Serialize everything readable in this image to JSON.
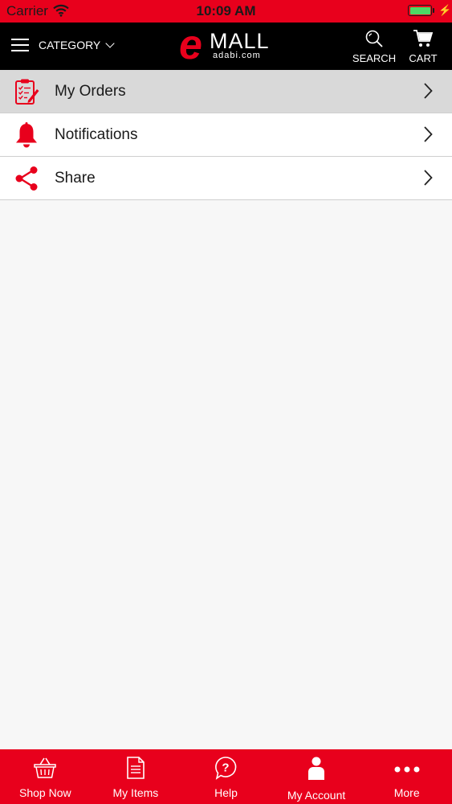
{
  "status_bar": {
    "carrier": "Carrier",
    "time": "10:09 AM",
    "battery_level": 1.0
  },
  "header": {
    "category_label": "CATEGORY",
    "logo_mark": "e",
    "logo_text": "MALL",
    "logo_subtext": "adabi.com",
    "search_label": "SEARCH",
    "cart_label": "CART"
  },
  "menu": {
    "items": [
      {
        "label": "My Orders",
        "icon": "clipboard-checklist-icon",
        "selected": true
      },
      {
        "label": "Notifications",
        "icon": "bell-icon",
        "selected": false
      },
      {
        "label": "Share",
        "icon": "share-icon",
        "selected": false
      }
    ]
  },
  "tabs": [
    {
      "label": "Shop Now",
      "icon": "basket-icon"
    },
    {
      "label": "My Items",
      "icon": "document-icon"
    },
    {
      "label": "Help",
      "icon": "help-bubble-icon"
    },
    {
      "label": "My Account",
      "icon": "person-icon",
      "active": true
    },
    {
      "label": "More",
      "icon": "more-dots-icon"
    }
  ],
  "colors": {
    "brand_red": "#e8001c",
    "header_black": "#000000",
    "selected_row": "#d9d9d9",
    "battery_green": "#4cd964"
  }
}
